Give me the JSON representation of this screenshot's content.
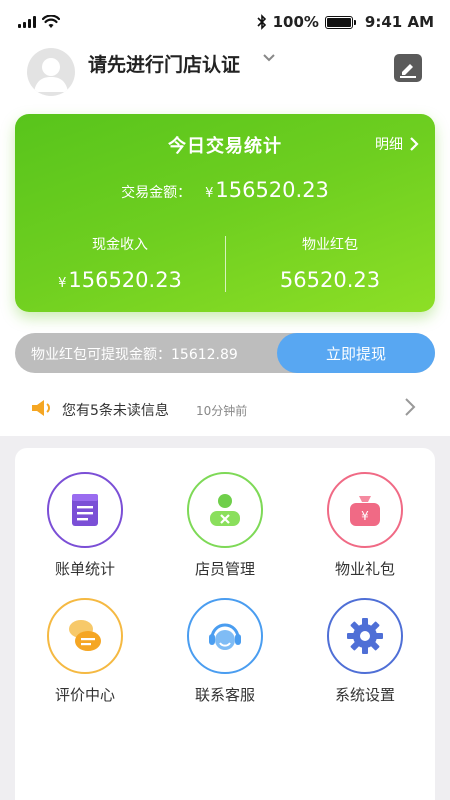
{
  "status_bar": {
    "battery": "100%",
    "time": "9:41 AM"
  },
  "header": {
    "store_title": "请先进行门店认证"
  },
  "stats": {
    "title": "今日交易统计",
    "detail_label": "明细",
    "total_label": "交易金额：",
    "currency": "¥",
    "total_value": "156520.23",
    "cash_label": "现金收入",
    "cash_value": "156520.23",
    "redpacket_label": "物业红包",
    "redpacket_value": "56520.23"
  },
  "withdraw": {
    "text": "物业红包可提现金额：15612.89",
    "button_label": "立即提现"
  },
  "notice": {
    "text": "您有5条未读信息",
    "time": "10分钟前"
  },
  "grid": [
    {
      "label": "账单统计",
      "icon": "bill-icon",
      "color": "#7b4fd6"
    },
    {
      "label": "店员管理",
      "icon": "staff-icon",
      "color": "#7ed957"
    },
    {
      "label": "物业礼包",
      "icon": "gift-bag-icon",
      "color": "#f06a85"
    },
    {
      "label": "评价中心",
      "icon": "chat-icon",
      "color": "#f5b942"
    },
    {
      "label": "联系客服",
      "icon": "headset-icon",
      "color": "#4a9df0"
    },
    {
      "label": "系统设置",
      "icon": "gear-icon",
      "color": "#4f6fd6"
    }
  ],
  "colors": {
    "card_green": "#6fcf20",
    "button_blue": "#58a7f2",
    "bar_gray": "#bdbdbd"
  }
}
